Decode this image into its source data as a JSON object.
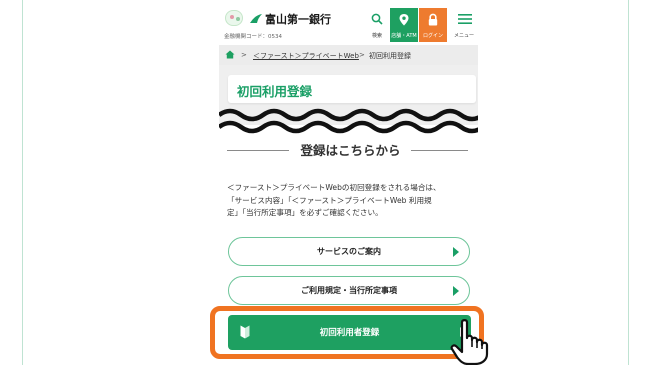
{
  "header": {
    "bank_name": "富山第一銀行",
    "bank_code": "金融機関コード：0534",
    "search_label": "検索",
    "store_label": "店舗・ATM",
    "login_label": "ログイン",
    "menu_label": "メニュー"
  },
  "breadcrumb": {
    "separator": ">",
    "items": [
      "＜ファースト＞プライベートWeb",
      "初回利用登録"
    ]
  },
  "page": {
    "title": "初回利用登録",
    "section_title": "登録はこちらから",
    "description": [
      "＜ファースト＞プライベートWebの初回登録をされる場合は、",
      "「サービス内容」「＜ファースト＞プライベートWeb 利用規",
      "定」「当行所定事項」を必ずご確認ください。"
    ]
  },
  "buttons": {
    "service_guide": "サービスのご案内",
    "terms": "ご利用規定・当行所定事項",
    "register": "初回利用者登録"
  },
  "colors": {
    "accent_green": "#1ea061",
    "login_orange": "#ee7b2f",
    "highlight_orange": "#f07321"
  },
  "icons": {
    "search": "search-icon",
    "store": "map-pin-icon",
    "login": "lock-icon",
    "menu": "hamburger-icon",
    "home": "home-icon",
    "register": "beginner-mark-icon",
    "pointer": "pointing-hand-icon"
  }
}
